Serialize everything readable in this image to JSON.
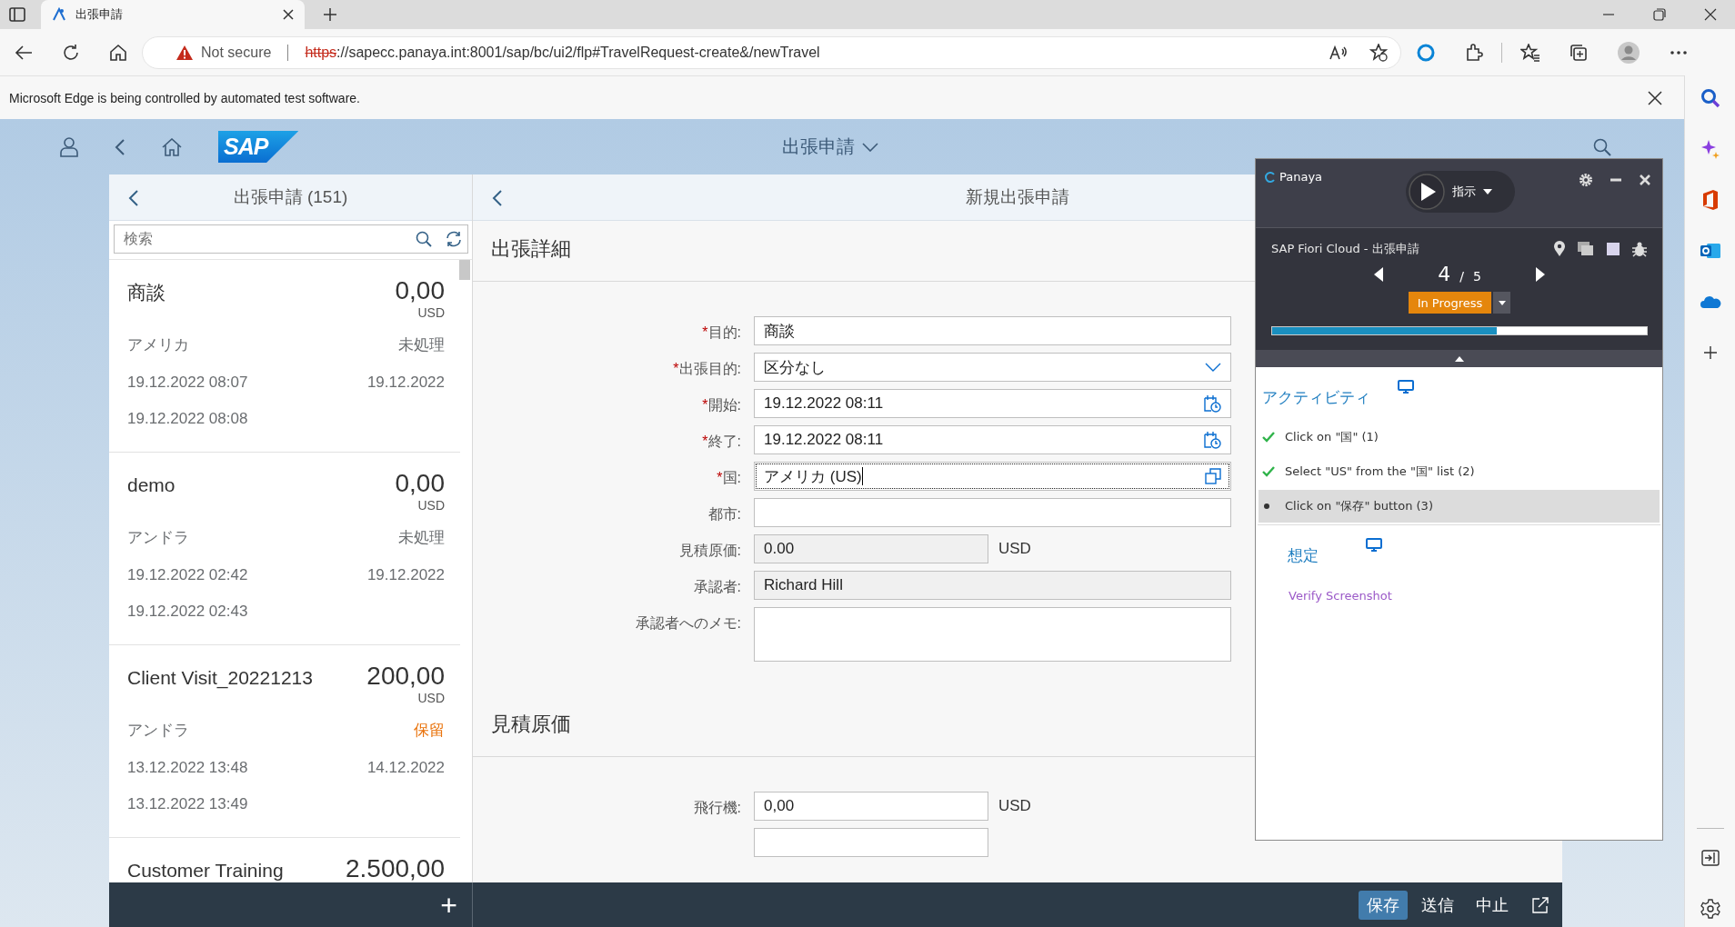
{
  "browser": {
    "tab_title": "出張申請",
    "security": "Not secure",
    "url_scheme": "https",
    "url_rest": "://sapecc.panaya.int:8001/sap/bc/ui2/flp#TravelRequest-create&/newTravel",
    "infobar": "Microsoft Edge is being controlled by automated test software."
  },
  "shell": {
    "logo": "SAP",
    "title": "出張申請"
  },
  "master": {
    "title": "出張申請 (151)",
    "search": {
      "placeholder": "検索"
    },
    "items": [
      {
        "title": "商談",
        "amount": "0,00",
        "currency": "USD",
        "country": "アメリカ",
        "status": "未処理",
        "color": "#6a6d70",
        "created": "19.12.2022 08:07",
        "date": "19.12.2022",
        "changed": "19.12.2022 08:08"
      },
      {
        "title": "demo",
        "amount": "0,00",
        "currency": "USD",
        "country": "アンドラ",
        "status": "未処理",
        "color": "#6a6d70",
        "created": "19.12.2022 02:42",
        "date": "19.12.2022",
        "changed": "19.12.2022 02:43"
      },
      {
        "title": "Client Visit_20221213",
        "amount": "200,00",
        "currency": "USD",
        "country": "アンドラ",
        "status": "保留",
        "color": "#e9730c",
        "created": "13.12.2022 13:48",
        "date": "14.12.2022",
        "changed": "13.12.2022 13:49"
      },
      {
        "title": "Customer Training",
        "amount": "2.500,00"
      }
    ],
    "add": "+"
  },
  "detail": {
    "title": "新規出張申請",
    "sections": [
      {
        "title": "出張詳細",
        "fields": [
          {
            "mark": "*",
            "label": "目的:",
            "kind": "text",
            "value": "商談",
            "focused": false
          },
          {
            "mark": "*",
            "label": "出張目的:",
            "kind": "select",
            "value": "区分なし",
            "focused": false
          },
          {
            "mark": "*",
            "label": "開始:",
            "kind": "date",
            "value": "19.12.2022 08:11",
            "focused": false
          },
          {
            "mark": "*",
            "label": "終了:",
            "kind": "date",
            "value": "19.12.2022 08:11",
            "focused": false
          },
          {
            "mark": "*",
            "label": "国:",
            "kind": "valuehelp",
            "value": "アメリカ (US)",
            "focused": true
          },
          {
            "label": "都市:",
            "kind": "text",
            "focused": false
          },
          {
            "label": "見積原価:",
            "kind": "readonly",
            "value": "0.00",
            "unit": "USD",
            "short": true,
            "focused": false
          },
          {
            "label": "承認者:",
            "kind": "readonly",
            "value": "Richard Hill",
            "focused": false
          },
          {
            "label": "承認者へのメモ:",
            "kind": "textarea",
            "focused": false
          }
        ]
      },
      {
        "title": "見積原価",
        "fields": [
          {
            "label": "飛行機:",
            "kind": "text",
            "value": "0,00",
            "unit": "USD",
            "short": true,
            "focused": false
          },
          {
            "kind": "text",
            "short": true,
            "focused": false
          }
        ]
      }
    ]
  },
  "footer": {
    "buttons": [
      {
        "label": "保存",
        "emphasized": true
      },
      {
        "label": "送信",
        "emphasized": false
      },
      {
        "label": "中止",
        "emphasized": false
      }
    ]
  },
  "panaya": {
    "brand": "Panaya",
    "mode": "指示",
    "test_name": "SAP Fiori Cloud - 出張申請",
    "step": "4",
    "separator": "/",
    "total": "5",
    "status": "In Progress",
    "level": 0.6,
    "sections": [
      {
        "title": "アクティビティ",
        "steps": [
          {
            "text": "Click on \"国\" (1)",
            "kind": "done",
            "selected": false
          },
          {
            "text": "Select \"US\" from the \"国\" list (2)",
            "kind": "done",
            "selected": false
          },
          {
            "text": "Click on \"保存\" button (3)",
            "kind": "current",
            "selected": true
          }
        ]
      },
      {
        "title": "想定",
        "steps": [
          {
            "text": "Verify Screenshot",
            "kind": "link",
            "selected": false
          }
        ]
      }
    ]
  }
}
